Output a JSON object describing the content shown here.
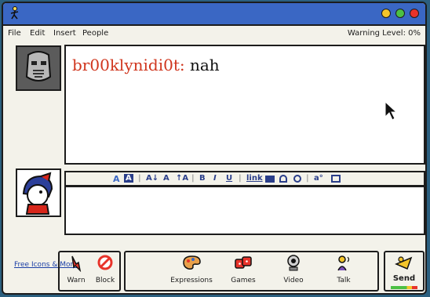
{
  "menu": {
    "items": [
      "File",
      "Edit",
      "Insert",
      "People"
    ],
    "warning_level": "Warning Level: 0%"
  },
  "conversation": {
    "sender": "br00klynidi0t:",
    "message": "nah"
  },
  "format_toolbar": {
    "link_label": "link"
  },
  "bottom": {
    "more_link": "Free Icons & More",
    "buttons": {
      "warn": "Warn",
      "block": "Block",
      "expressions": "Expressions",
      "games": "Games",
      "video": "Video",
      "talk": "Talk",
      "send": "Send"
    }
  },
  "colors": {
    "titlebar": "#3a67c4",
    "sender": "#d0361e",
    "link": "#1b3fa6"
  }
}
